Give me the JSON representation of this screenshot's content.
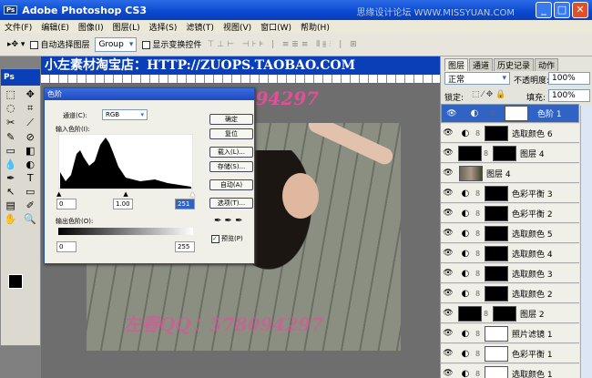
{
  "window": {
    "title": "Adobe Photoshop CS3",
    "ps_badge": "Ps",
    "site_watermark": "思缘设计论坛 WWW.MISSYUAN.COM"
  },
  "menu": [
    "文件(F)",
    "编辑(E)",
    "图像(I)",
    "图层(L)",
    "选择(S)",
    "滤镜(T)",
    "视图(V)",
    "窗口(W)",
    "帮助(H)"
  ],
  "options": {
    "auto_select": "自动选择图层",
    "group": "Group",
    "show_transform": "显示变换控件"
  },
  "watermarks": {
    "banner": "小左素材淘宝店：HTTP://ZUOPS.TAOBAO.COM",
    "qq": "左春QQ：578094297"
  },
  "toolbox": {
    "title": "Ps"
  },
  "levels": {
    "title": "色阶",
    "channel_label": "通道(C):",
    "channel": "RGB",
    "input_label": "输入色阶(I):",
    "input": [
      "0",
      "1.00",
      "251"
    ],
    "output_label": "输出色阶(O):",
    "output": [
      "0",
      "255"
    ],
    "buttons": [
      "确定",
      "复位",
      "载入(L)...",
      "存储(S)...",
      "自动(A)",
      "选项(T)..."
    ],
    "preview": "预览(P)"
  },
  "layers_panel": {
    "tabs": [
      "图层",
      "通道",
      "历史记录",
      "动作"
    ],
    "blend": "正常",
    "opacity_label": "不透明度:",
    "opacity": "100%",
    "lock_label": "锁定:",
    "fill_label": "填充:",
    "fill": "100%",
    "layers": [
      {
        "name": "色阶 1",
        "selected": true,
        "thumb": "white"
      },
      {
        "name": "选取颜色 6",
        "thumb": "black"
      },
      {
        "name": "图层 4",
        "thumb": "black"
      },
      {
        "name": "图层 4",
        "thumb": "photo"
      },
      {
        "name": "色彩平衡 3",
        "thumb": "black"
      },
      {
        "name": "色彩平衡 2",
        "thumb": "black"
      },
      {
        "name": "选取颜色 5",
        "thumb": "black"
      },
      {
        "name": "选取颜色 4",
        "thumb": "black"
      },
      {
        "name": "选取颜色 3",
        "thumb": "black"
      },
      {
        "name": "选取颜色 2",
        "thumb": "black"
      },
      {
        "name": "图层 2",
        "thumb": "black"
      },
      {
        "name": "照片滤镜 1",
        "thumb": "white"
      },
      {
        "name": "色彩平衡 1",
        "thumb": "white"
      },
      {
        "name": "选取颜色 1",
        "thumb": "white"
      }
    ]
  }
}
